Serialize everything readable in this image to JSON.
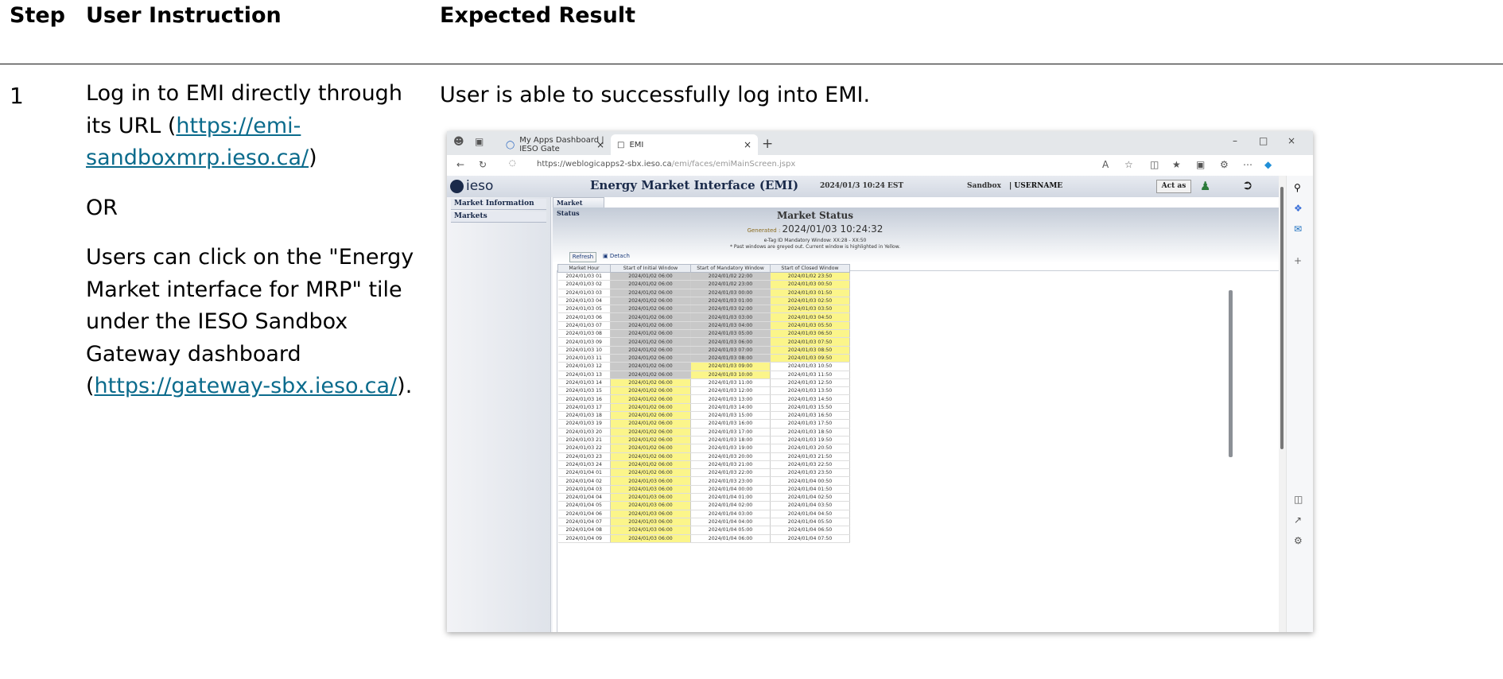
{
  "doc": {
    "headers": {
      "step": "Step",
      "instruction": "User Instruction",
      "result": "Expected Result"
    },
    "step_number": "1",
    "instruction": {
      "p1_pre": "Log in to EMI directly through its URL (",
      "p1_link": "https://emi-sandboxmrp.ieso.ca/",
      "p1_post": ")",
      "p2": "OR",
      "p3_pre": "Users can click on the \"Energy Market interface for MRP\" tile under the IESO Sandbox Gateway dashboard (",
      "p3_link": "https://gateway-sbx.ieso.ca/",
      "p3_post": ")."
    },
    "result_text": "User is able to successfully log into EMI."
  },
  "browser": {
    "tab1": "My Apps Dashboard | IESO Gate",
    "tab2": "EMI",
    "url_host": "https://weblogicapps2-sbx.ieso.ca",
    "url_path": "/emi/faces/emiMainScreen.jspx"
  },
  "emi": {
    "logo": "ieso",
    "title": "Energy Market Interface (EMI)",
    "date": "2024/01/3 10:24 EST",
    "environment": "Sandbox",
    "user": "USERNAME",
    "act_as": "Act as",
    "sidebar": [
      "Market Information",
      "Markets"
    ],
    "tab": "Market Status",
    "heading": "Market Status",
    "generated_label": "Generated : ",
    "generated_value": "2024/01/03 10:24:32",
    "note1": "e-Tag ID Mandatory Window: XX:28 - XX:50",
    "note2": "* Past windows are greyed out. Current window is highlighted in Yellow.",
    "refresh": "Refresh",
    "detach": "Detach",
    "columns": [
      "Market Hour",
      "Start of Initial Window",
      "Start of Mandatory Window",
      "Start of Closed Window"
    ],
    "rows": [
      [
        "2024/01/03 01",
        "2024/01/02 06:00",
        "2024/01/02 22:00",
        "2024/01/02 23:50"
      ],
      [
        "2024/01/03 02",
        "2024/01/02 06:00",
        "2024/01/02 23:00",
        "2024/01/03 00:50"
      ],
      [
        "2024/01/03 03",
        "2024/01/02 06:00",
        "2024/01/03 00:00",
        "2024/01/03 01:50"
      ],
      [
        "2024/01/03 04",
        "2024/01/02 06:00",
        "2024/01/03 01:00",
        "2024/01/03 02:50"
      ],
      [
        "2024/01/03 05",
        "2024/01/02 06:00",
        "2024/01/03 02:00",
        "2024/01/03 03:50"
      ],
      [
        "2024/01/03 06",
        "2024/01/02 06:00",
        "2024/01/03 03:00",
        "2024/01/03 04:50"
      ],
      [
        "2024/01/03 07",
        "2024/01/02 06:00",
        "2024/01/03 04:00",
        "2024/01/03 05:50"
      ],
      [
        "2024/01/03 08",
        "2024/01/02 06:00",
        "2024/01/03 05:00",
        "2024/01/03 06:50"
      ],
      [
        "2024/01/03 09",
        "2024/01/02 06:00",
        "2024/01/03 06:00",
        "2024/01/03 07:50"
      ],
      [
        "2024/01/03 10",
        "2024/01/02 06:00",
        "2024/01/03 07:00",
        "2024/01/03 08:50"
      ],
      [
        "2024/01/03 11",
        "2024/01/02 06:00",
        "2024/01/03 08:00",
        "2024/01/03 09:50"
      ],
      [
        "2024/01/03 12",
        "2024/01/02 06:00",
        "2024/01/03 09:00",
        "2024/01/03 10:50"
      ],
      [
        "2024/01/03 13",
        "2024/01/02 06:00",
        "2024/01/03 10:00",
        "2024/01/03 11:50"
      ],
      [
        "2024/01/03 14",
        "2024/01/02 06:00",
        "2024/01/03 11:00",
        "2024/01/03 12:50"
      ],
      [
        "2024/01/03 15",
        "2024/01/02 06:00",
        "2024/01/03 12:00",
        "2024/01/03 13:50"
      ],
      [
        "2024/01/03 16",
        "2024/01/02 06:00",
        "2024/01/03 13:00",
        "2024/01/03 14:50"
      ],
      [
        "2024/01/03 17",
        "2024/01/02 06:00",
        "2024/01/03 14:00",
        "2024/01/03 15:50"
      ],
      [
        "2024/01/03 18",
        "2024/01/02 06:00",
        "2024/01/03 15:00",
        "2024/01/03 16:50"
      ],
      [
        "2024/01/03 19",
        "2024/01/02 06:00",
        "2024/01/03 16:00",
        "2024/01/03 17:50"
      ],
      [
        "2024/01/03 20",
        "2024/01/02 06:00",
        "2024/01/03 17:00",
        "2024/01/03 18:50"
      ],
      [
        "2024/01/03 21",
        "2024/01/02 06:00",
        "2024/01/03 18:00",
        "2024/01/03 19:50"
      ],
      [
        "2024/01/03 22",
        "2024/01/02 06:00",
        "2024/01/03 19:00",
        "2024/01/03 20:50"
      ],
      [
        "2024/01/03 23",
        "2024/01/02 06:00",
        "2024/01/03 20:00",
        "2024/01/03 21:50"
      ],
      [
        "2024/01/03 24",
        "2024/01/02 06:00",
        "2024/01/03 21:00",
        "2024/01/03 22:50"
      ],
      [
        "2024/01/04 01",
        "2024/01/02 06:00",
        "2024/01/03 22:00",
        "2024/01/03 23:50"
      ],
      [
        "2024/01/04 02",
        "2024/01/03 06:00",
        "2024/01/03 23:00",
        "2024/01/04 00:50"
      ],
      [
        "2024/01/04 03",
        "2024/01/03 06:00",
        "2024/01/04 00:00",
        "2024/01/04 01:50"
      ],
      [
        "2024/01/04 04",
        "2024/01/03 06:00",
        "2024/01/04 01:00",
        "2024/01/04 02:50"
      ],
      [
        "2024/01/04 05",
        "2024/01/03 06:00",
        "2024/01/04 02:00",
        "2024/01/04 03:50"
      ],
      [
        "2024/01/04 06",
        "2024/01/03 06:00",
        "2024/01/04 03:00",
        "2024/01/04 04:50"
      ],
      [
        "2024/01/04 07",
        "2024/01/03 06:00",
        "2024/01/04 04:00",
        "2024/01/04 05:50"
      ],
      [
        "2024/01/04 08",
        "2024/01/03 06:00",
        "2024/01/04 05:00",
        "2024/01/04 06:50"
      ],
      [
        "2024/01/04 09",
        "2024/01/03 06:00",
        "2024/01/04 06:00",
        "2024/01/04 07:50"
      ]
    ],
    "row_states": [
      [
        "n",
        "g",
        "g",
        "y"
      ],
      [
        "n",
        "g",
        "g",
        "y"
      ],
      [
        "n",
        "g",
        "g",
        "y"
      ],
      [
        "n",
        "g",
        "g",
        "y"
      ],
      [
        "n",
        "g",
        "g",
        "y"
      ],
      [
        "n",
        "g",
        "g",
        "y"
      ],
      [
        "n",
        "g",
        "g",
        "y"
      ],
      [
        "n",
        "g",
        "g",
        "y"
      ],
      [
        "n",
        "g",
        "g",
        "y"
      ],
      [
        "n",
        "g",
        "g",
        "y"
      ],
      [
        "n",
        "g",
        "g",
        "y"
      ],
      [
        "n",
        "g",
        "y",
        "n"
      ],
      [
        "n",
        "g",
        "y",
        "n"
      ],
      [
        "n",
        "y",
        "n",
        "n"
      ],
      [
        "n",
        "y",
        "n",
        "n"
      ],
      [
        "n",
        "y",
        "n",
        "n"
      ],
      [
        "n",
        "y",
        "n",
        "n"
      ],
      [
        "n",
        "y",
        "n",
        "n"
      ],
      [
        "n",
        "y",
        "n",
        "n"
      ],
      [
        "n",
        "y",
        "n",
        "n"
      ],
      [
        "n",
        "y",
        "n",
        "n"
      ],
      [
        "n",
        "y",
        "n",
        "n"
      ],
      [
        "n",
        "y",
        "n",
        "n"
      ],
      [
        "n",
        "y",
        "n",
        "n"
      ],
      [
        "n",
        "y",
        "n",
        "n"
      ],
      [
        "n",
        "y",
        "n",
        "n"
      ],
      [
        "n",
        "y",
        "n",
        "n"
      ],
      [
        "n",
        "y",
        "n",
        "n"
      ],
      [
        "n",
        "y",
        "n",
        "n"
      ],
      [
        "n",
        "y",
        "n",
        "n"
      ],
      [
        "n",
        "y",
        "n",
        "n"
      ],
      [
        "n",
        "y",
        "n",
        "n"
      ],
      [
        "n",
        "y",
        "n",
        "n"
      ]
    ],
    "colors": {
      "greyed": "#c8c8c8",
      "current": "#fbf58a"
    }
  }
}
